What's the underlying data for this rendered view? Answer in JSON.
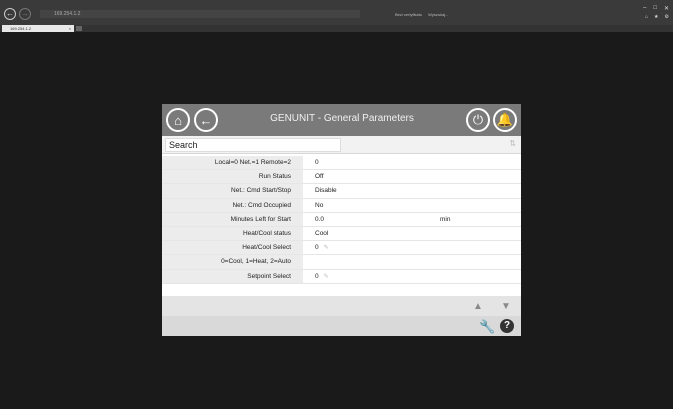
{
  "browser": {
    "address": "169.254.1.2",
    "suggest_1": "Bezi certyfikatu",
    "suggest_2": "Wyszukaj...",
    "tab_label": "169.254.1.2",
    "tab_close": "×"
  },
  "header": {
    "title": "GENUNIT - General Parameters"
  },
  "search": {
    "placeholder": "Search"
  },
  "rows": [
    {
      "label": "Local=0 Net.=1 Remote=2",
      "value": "0",
      "unit": ""
    },
    {
      "label": "Run Status",
      "value": "Off",
      "unit": ""
    },
    {
      "label": "Net.: Cmd Start/Stop",
      "value": "Disable",
      "unit": ""
    },
    {
      "label": "Net.: Cmd Occupied",
      "value": "No",
      "unit": ""
    },
    {
      "label": "Minutes Left for Start",
      "value": "0.0",
      "unit": "min"
    },
    {
      "label": "Heat/Cool status",
      "value": "Cool",
      "unit": ""
    },
    {
      "label": "Heat/Cool Select",
      "value": "0",
      "unit": ""
    },
    {
      "label": "0=Cool, 1=Heat, 2=Auto",
      "value": "",
      "unit": ""
    },
    {
      "label": "Setpoint Select",
      "value": "0",
      "unit": ""
    }
  ],
  "icons": {
    "home": "home-icon",
    "back": "back-arrow-icon",
    "power": "power-icon",
    "alarm": "bell-icon",
    "sort": "sort-icon",
    "up": "arrow-up-icon",
    "down": "arrow-down-icon",
    "tools": "wrench-icon",
    "help": "help-icon"
  },
  "colors": {
    "header_bg": "#7a7a7a",
    "background": "#1a1a1a"
  }
}
